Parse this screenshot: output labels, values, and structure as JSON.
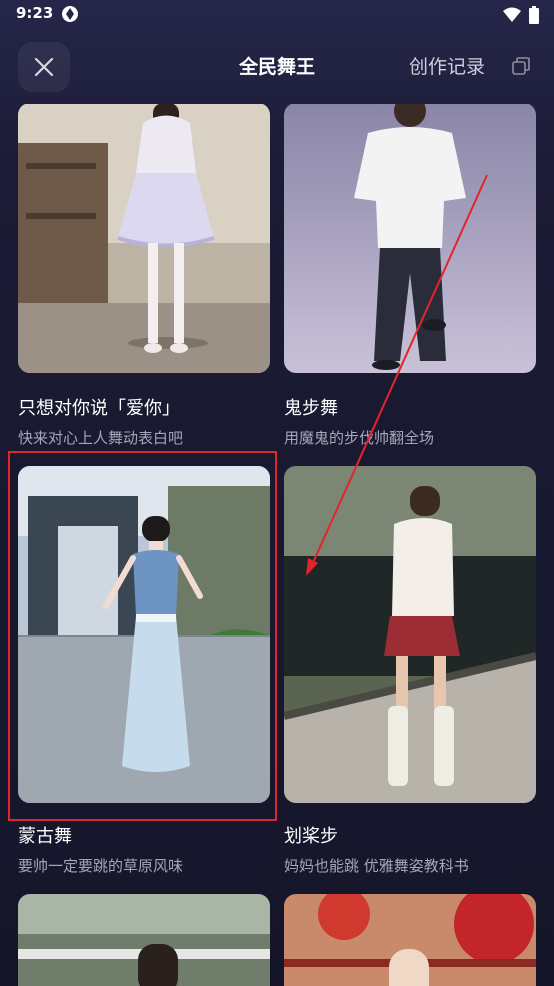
{
  "status_bar": {
    "time": "9:23"
  },
  "header": {
    "title": "全民舞王",
    "record_label": "创作记录"
  },
  "cards": [
    {
      "title": "只想对你说「爱你」",
      "subtitle": "快来对心上人舞动表白吧"
    },
    {
      "title": "鬼步舞",
      "subtitle": "用魔鬼的步伐帅翻全场"
    },
    {
      "title": "蒙古舞",
      "subtitle": "要帅一定要跳的草原风味"
    },
    {
      "title": "划桨步",
      "subtitle": "妈妈也能跳 优雅舞姿教科书"
    },
    {
      "title": "",
      "subtitle": ""
    },
    {
      "title": "",
      "subtitle": ""
    }
  ],
  "colors": {
    "highlight": "#e0262b",
    "background": "#15152a"
  }
}
